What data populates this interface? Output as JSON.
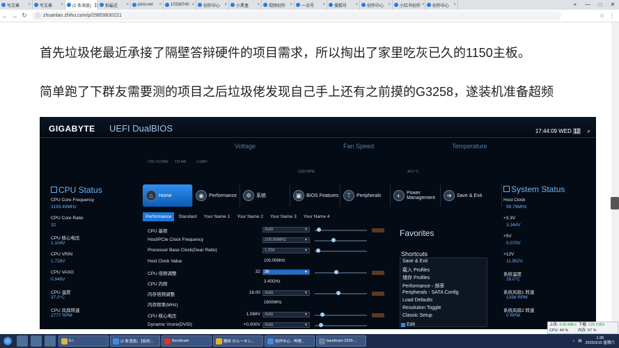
{
  "browser": {
    "tabs": [
      {
        "label": "写文章",
        "active": false
      },
      {
        "label": "写文章",
        "active": false
      },
      {
        "label": "(2 条消息) 【如何...",
        "active": true
      },
      {
        "label": "拍最近",
        "active": false
      },
      {
        "label": "pixiv.net",
        "active": false
      },
      {
        "label": "10336740",
        "active": false
      },
      {
        "label": "创作中心",
        "active": false
      },
      {
        "label": "小黑盒",
        "active": false
      },
      {
        "label": "视频创作",
        "active": false
      },
      {
        "label": "一点号",
        "active": false
      },
      {
        "label": "搜狐号",
        "active": false
      },
      {
        "label": "创作中心",
        "active": false
      },
      {
        "label": "小红书创作",
        "active": false
      },
      {
        "label": "创作中心",
        "active": false
      }
    ],
    "window_controls": [
      "+",
      "—",
      "□",
      "✕"
    ],
    "url": "zhuanlan.zhihu.com/p/29859830221",
    "nav": [
      "←",
      "→",
      "↻"
    ],
    "right_icons": [
      "☆",
      "⋮"
    ]
  },
  "article": {
    "para1": "首先垃圾佬最近承接了隔壁答辩硬件的项目需求，所以掏出了家里吃灰已久的1150主板。",
    "para2": "简单跑了下群友需要测的项目之后垃圾佬发现自己手上还有之前摸的G3258，遂装机准备超频"
  },
  "bios": {
    "brand": "GIGABYTE",
    "subtitle": "UEFI DualBIOS",
    "time": "17:44:09 WED",
    "day": "12",
    "top_groups": [
      "Voltage",
      "Fan Speed",
      "Temperature"
    ],
    "voltage_readings": [
      "CPU VCORE",
      "CH A/B",
      "1.580V"
    ],
    "fan_reading": "1333 RPM",
    "temp_reading": "40.0 °C",
    "cpu_status": {
      "title": "CPU Status",
      "items": [
        {
          "k": "CPU Core Frequency",
          "v": "3193.49MHz"
        },
        {
          "k": "CPU Core Ratio",
          "v": "32"
        },
        {
          "k": "CPU 核心电压",
          "v": "1.104V"
        },
        {
          "k": "CPU VRIN",
          "v": "1.728V"
        },
        {
          "k": "CPU VAXG",
          "v": "0.948V"
        },
        {
          "k": "CPU 温度",
          "v": "37.0°C"
        },
        {
          "k": "CPU 风扇转速",
          "v": "2777 RPM"
        }
      ]
    },
    "system_status": {
      "title": "System Status",
      "items": [
        {
          "k": "Host Clock",
          "v": "99.79MHz"
        },
        {
          "k": "+3.3V",
          "v": "3.344V"
        },
        {
          "k": "+5V",
          "v": "5.070V"
        },
        {
          "k": "+12V",
          "v": "11.952V"
        },
        {
          "k": "系统温度",
          "v": "28.0°C"
        },
        {
          "k": "系统风扇1 转速",
          "v": "1336 RPM"
        },
        {
          "k": "系统风扇2 转速",
          "v": "0 RPM"
        }
      ]
    },
    "nav": [
      {
        "label": "Home",
        "icon": "home-icon",
        "glyph": "⌂",
        "active": true
      },
      {
        "label": "Performance",
        "icon": "gauge-icon",
        "glyph": "◉",
        "active": false
      },
      {
        "label": "系统",
        "icon": "gear-icon",
        "glyph": "✲",
        "active": false
      },
      {
        "label": "BIOS Features",
        "icon": "chip-icon",
        "glyph": "▣",
        "active": false
      },
      {
        "label": "Peripherals",
        "icon": "plug-icon",
        "glyph": "⊤",
        "active": false
      },
      {
        "label": "Power Management",
        "icon": "power-icon",
        "glyph": "◐",
        "active": false
      },
      {
        "label": "Save & Exit",
        "icon": "exit-icon",
        "glyph": "➜",
        "active": false
      }
    ],
    "subtabs": [
      {
        "label": "Performance",
        "active": true
      },
      {
        "label": "Standard",
        "active": false
      },
      {
        "label": "Your Name 1",
        "active": false
      },
      {
        "label": "Your Name 2",
        "active": false
      },
      {
        "label": "Your Name 3",
        "active": false
      },
      {
        "label": "Your Name 4",
        "active": false
      }
    ],
    "settings": [
      {
        "label": "CPU 基频",
        "num": "",
        "field": "Auto",
        "dropdown": true,
        "selected": false,
        "slider": 0.05,
        "pad": true
      },
      {
        "label": "Host/PCIe Clock Frequency",
        "num": "",
        "field": "100.00MHz",
        "dropdown": true,
        "selected": false,
        "slider": 0.35,
        "pad": false
      },
      {
        "label": "Processor Base Clock(Gear Ratio)",
        "num": "",
        "field": "1.00x",
        "dropdown": true,
        "selected": false,
        "slider": 0.03,
        "pad": false
      },
      {
        "label": "Host Clock Value",
        "num": "",
        "field": "100.00MHz",
        "dropdown": false,
        "selected": false,
        "slider": null,
        "pad": false
      },
      {
        "label": "CPU 倍频调整",
        "num": "32",
        "field": "36",
        "dropdown": true,
        "selected": true,
        "slider": 0.4,
        "pad": true
      },
      {
        "label": "CPU 内频",
        "num": "",
        "field": "3.40GHz",
        "dropdown": false,
        "selected": false,
        "slider": null,
        "pad": false
      },
      {
        "label": "内存倍频调整",
        "num": "16.00",
        "field": "Auto",
        "dropdown": true,
        "selected": false,
        "slider": 0.45,
        "pad": true
      },
      {
        "label": "内存频率(MHz)",
        "num": "",
        "field": "1600MHz",
        "dropdown": false,
        "selected": false,
        "slider": null,
        "pad": false
      },
      {
        "label": "CPU 核心电压",
        "num": "1.088V",
        "field": "Auto",
        "dropdown": true,
        "selected": false,
        "slider": 0.12,
        "pad": true
      },
      {
        "label": "Dynamic Vcore(DVID)",
        "num": "+0.000V",
        "field": "Auto",
        "dropdown": true,
        "selected": false,
        "slider": 0.08,
        "pad": false
      }
    ],
    "favorites_title": "Favorites",
    "shortcuts_title": "Shortcuts",
    "shortcuts": [
      "Save & Exit",
      "载入 Profiles",
      "储存 Profiles",
      "Performance - 频率",
      "Peripherals - SATA Config",
      "Load Defaults",
      "Resolution Toggle",
      "Classic Setup"
    ],
    "edit_label": "Edit"
  },
  "netmon": {
    "up_label": "上传",
    "up": "4.66 MB/s",
    "down_label": "下载",
    "down": "125.0 B/s",
    "cpu_label": "CPU",
    "cpu": "44 %",
    "mem_label": "内存",
    "mem": "57 %"
  },
  "taskbar": {
    "tasks": [
      {
        "label": "E:\\",
        "color": "#d9b24a"
      },
      {
        "label": "(2 条消息) 【如何...",
        "color": "#3f8ae0"
      },
      {
        "label": "Bandicam",
        "color": "#d8362a"
      },
      {
        "label": "搬砖 のルーキン...",
        "color": "#e3b230"
      },
      {
        "label": "创作中心 - 哔哩...",
        "color": "#3f8ae0"
      },
      {
        "label": "bandicam 2025-...",
        "color": "#6b7f9a"
      }
    ],
    "time": "1:39",
    "date": "2025/3/15 星期六"
  },
  "colors": {
    "bios_accent": "#1d75d6",
    "bios_bg": "#050b14",
    "taskbar": "#1c2b4a"
  }
}
